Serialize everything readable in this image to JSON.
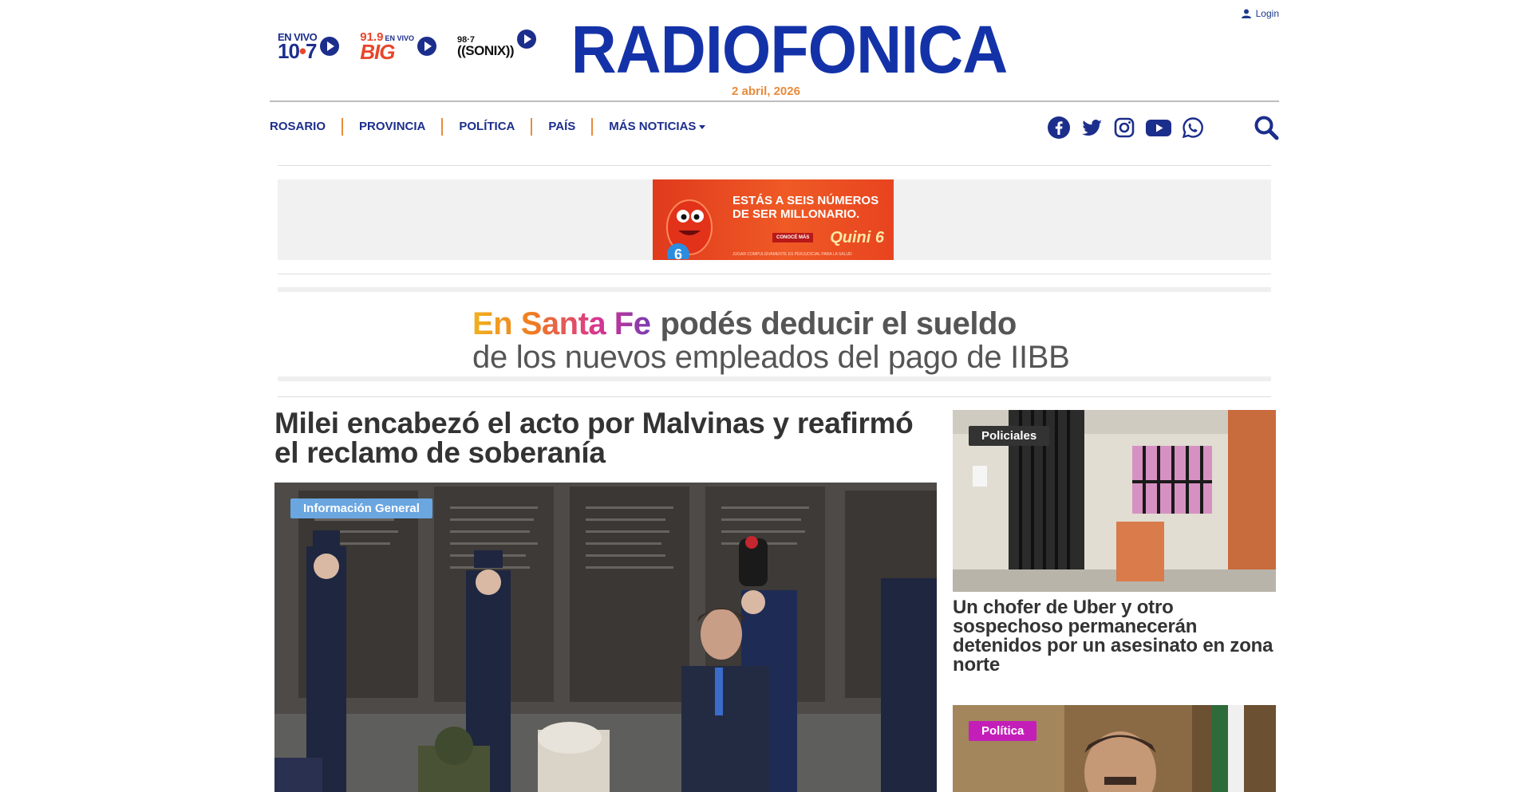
{
  "header": {
    "login_label": "Login",
    "brand": "RADIOFONICA",
    "date": "2 abril, 2026",
    "radios": [
      {
        "top": "EN VIVO",
        "main_a": "10",
        "main_b": "•",
        "main_c": "7"
      },
      {
        "top": "91.9",
        "top_small": "EN VIVO",
        "main": "BIG"
      },
      {
        "top": "98·7",
        "main": "((SONIX))"
      }
    ]
  },
  "nav": {
    "items": [
      "ROSARIO",
      "PROVINCIA",
      "POLÍTICA",
      "PAÍS",
      "MÁS NOTICIAS"
    ],
    "social_icons": [
      "facebook-icon",
      "twitter-icon",
      "instagram-icon",
      "youtube-icon",
      "whatsapp-icon"
    ]
  },
  "ads": {
    "quini": {
      "headline": "ESTÁS A SEIS NÚMEROS DE SER MILLONARIO.",
      "brand": "Quini 6",
      "cta": "CONOCÉ MÁS",
      "fine_print": "JUGAR COMPULSIVAMENTE ES PERJUDICIAL PARA LA SALUD"
    },
    "santa_fe": {
      "lead": "En Santa Fe",
      "line1": "podés deducir el sueldo",
      "line2": "de los nuevos empleados del pago de IIBB"
    }
  },
  "main_story": {
    "title": "Milei encabezó el acto por Malvinas y reafirmó el reclamo de soberanía",
    "tag": "Información General"
  },
  "side_stories": [
    {
      "tag": "Policiales",
      "title": "Un chofer de Uber y otro sospechoso permanecerán detenidos por un asesinato en zona norte"
    },
    {
      "tag": "Política",
      "title": ""
    }
  ],
  "colors": {
    "brand_blue": "#1432a8",
    "nav_blue": "#1c2e8c",
    "accent_orange": "#e88b3a",
    "tag_blue": "#6aa6e0",
    "tag_dark": "#333333",
    "tag_purple": "#c31fb8"
  }
}
